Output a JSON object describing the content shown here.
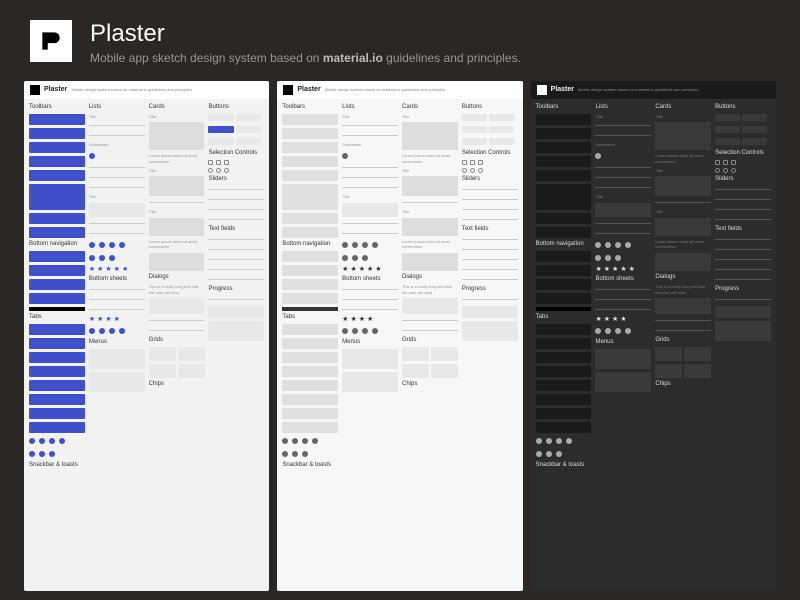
{
  "header": {
    "title": "Plaster",
    "subtitle_pre": "Mobile app sketch design system based on ",
    "subtitle_bold": "material.io",
    "subtitle_post": " guidelines and principles."
  },
  "panel_title": "Plaster",
  "panel_sub": "Mobile design system based on material.io guidelines and principles",
  "sections": {
    "toolbars": "Toolbars",
    "lists": "Lists",
    "cards": "Cards",
    "buttons": "Buttons",
    "selection": "Selection Controls",
    "sliders": "Sliders",
    "bottomnav": "Bottom navigation",
    "textfields": "Text fields",
    "bottomsheets": "Bottom sheets",
    "tabs": "Tabs",
    "dialogs": "Dialogs",
    "progress": "Progress",
    "grids": "Grids",
    "menus": "Menus",
    "snackbar": "Snackbar & toasts",
    "chips": "Chips"
  },
  "micro": {
    "title": "Title",
    "subheader": "Subheader",
    "lorem": "Lorem ipsum dolor sit amet consectetur",
    "dialog_text": "This is a really long text that the user will read"
  }
}
